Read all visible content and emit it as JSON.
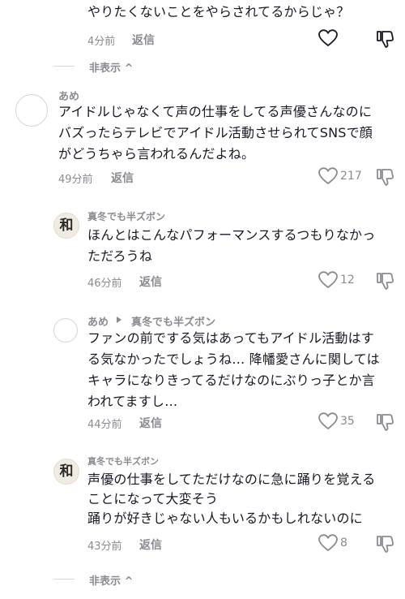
{
  "thread": {
    "prev_comment": {
      "text_line": "やりたくないことをやらされてるからじゃ？",
      "time": "4分前",
      "reply_label": "返信"
    },
    "hide_top_label": "非表示 ^",
    "comment1": {
      "author": "あめ",
      "lines": [
        "アイドルじゃなくて声の仕事をしてる声優さんなのに",
        "バズったらテレビでアイドル活動させられてSNSで顔",
        "がどうちゃら言われるんだよね。"
      ],
      "time": "49分前",
      "reply_label": "返信",
      "likes": "217"
    },
    "reply1": {
      "author": "真冬でも半ズボン",
      "lines": [
        "ほんとはこんなパフォーマンスするつもりなかっ",
        "ただろうね"
      ],
      "time": "46分前",
      "reply_label": "返信",
      "likes": "12"
    },
    "reply2": {
      "author": "あめ",
      "reply_to": "真冬でも半ズボン",
      "lines": [
        "ファンの前でする気はあってもアイドル活動はす",
        "る気なかったでしょうね… 降幡愛さんに関しては",
        "キャラになりきってるだけなのにぶりっ子とか言",
        "われてますし…"
      ],
      "time": "44分前",
      "reply_label": "返信",
      "likes": "35"
    },
    "reply3": {
      "author": "真冬でも半ズボン",
      "lines": [
        "声優の仕事をしてただけなのに急に踊りを覚える",
        "ことになって大変そう",
        "踊りが好きじゃない人もいるかもしれないのに"
      ],
      "time": "43分前",
      "reply_label": "返信",
      "likes": "8"
    },
    "hide_bottom_label": "非表示 ^",
    "avatar_glyph": "和"
  },
  "icons": [
    "heart-icon",
    "dislike-icon",
    "chevron-up-icon",
    "caret-right-icon"
  ],
  "colors": {
    "text": "#161823",
    "muted": "#8a8b91",
    "line": "#d8d8dc"
  }
}
